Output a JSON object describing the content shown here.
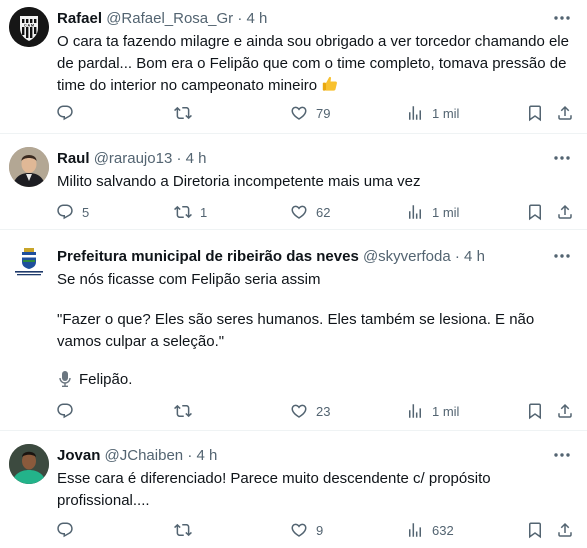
{
  "tweets": [
    {
      "name": "Rafael",
      "handle": "@Rafael_Rosa_Gr",
      "time": "· 4 h",
      "text": "O cara ta fazendo milagre e ainda sou obrigado a ver torcedor chamando ele de pardal... Bom era o Felipão que com o time completo, tomava pressão de time do interior no campeonato mineiro",
      "emoji": "👍",
      "replies": "",
      "retweets": "",
      "likes": "79",
      "views": "1 mil"
    },
    {
      "name": "Raul",
      "handle": "@raraujo13",
      "time": "· 4 h",
      "text": "Milito salvando a Diretoria incompetente mais uma vez",
      "replies": "5",
      "retweets": "1",
      "likes": "62",
      "views": "1 mil"
    },
    {
      "name": "Prefeitura municipal de ribeirão das neves",
      "handle": "@skyverfoda",
      "time": "· 4 h",
      "text_line1": "Se nós ficasse com Felipão seria assim",
      "quote": "\"Fazer o que? Eles são seres humanos. Eles também se lesiona. E não vamos culpar a seleção.\"",
      "mic_label": "Felipão.",
      "avatar_caption": "PREFEITURA MUNICIPAL DE RIBEIRÃO DAS NEVES",
      "replies": "",
      "retweets": "",
      "likes": "23",
      "views": "1 mil"
    },
    {
      "name": "Jovan",
      "handle": "@JChaiben",
      "time": "· 4 h",
      "text": "Esse cara é diferenciado! Parece muito descendente c/ propósito profissional....",
      "replies": "",
      "retweets": "",
      "likes": "9",
      "views": "632"
    }
  ],
  "colors": {
    "text": "#0f1419",
    "muted": "#536471",
    "divider": "#eff3f4"
  },
  "icons": [
    "reply-icon",
    "retweet-icon",
    "like-icon",
    "views-icon",
    "bookmark-icon",
    "share-icon",
    "more-icon",
    "microphone-icon"
  ]
}
